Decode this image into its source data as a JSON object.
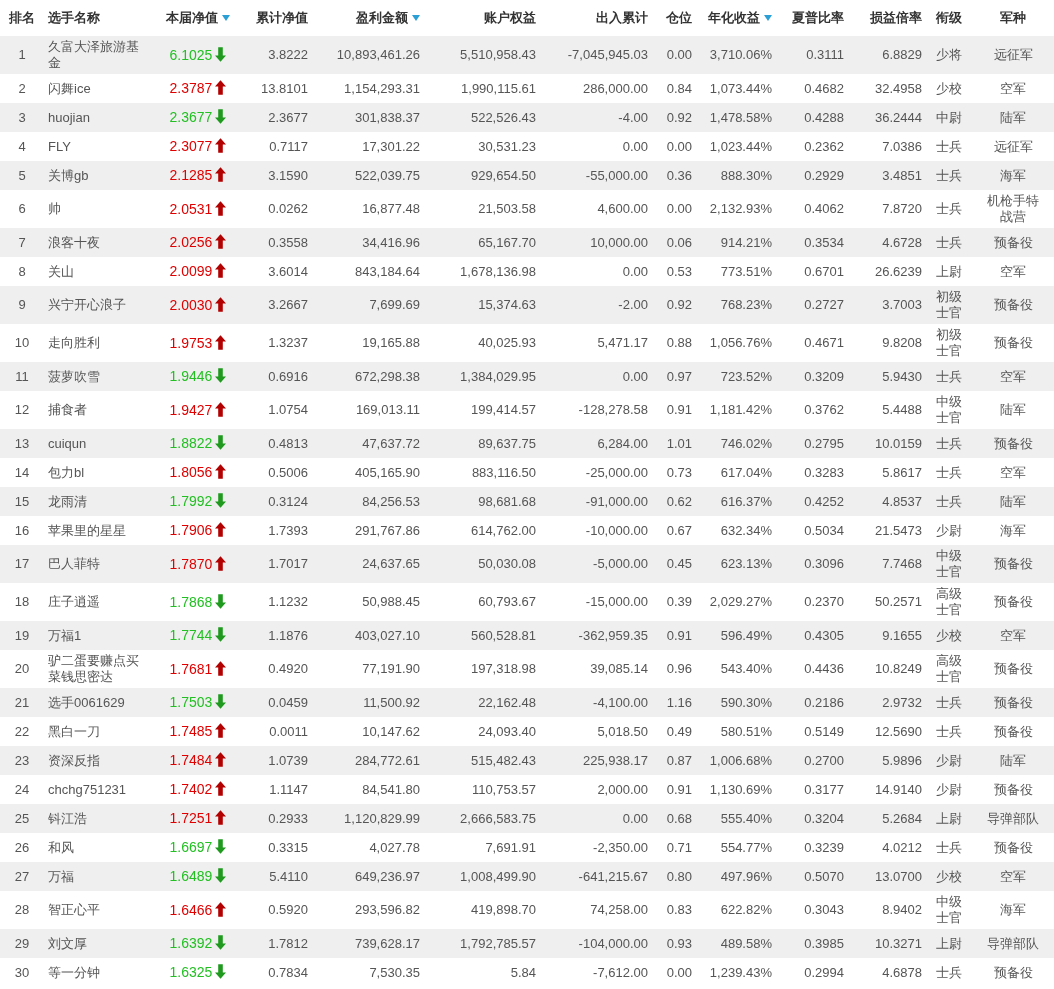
{
  "table": {
    "columns": [
      {
        "label": "排名",
        "sort_icon": false
      },
      {
        "label": "选手名称",
        "sort_icon": false
      },
      {
        "label": "本届净值",
        "sort_icon": true
      },
      {
        "label": "累计净值",
        "sort_icon": false
      },
      {
        "label": "盈利金额",
        "sort_icon": true
      },
      {
        "label": "账户权益",
        "sort_icon": false
      },
      {
        "label": "出入累计",
        "sort_icon": false
      },
      {
        "label": "仓位",
        "sort_icon": false
      },
      {
        "label": "年化收益",
        "sort_icon": true
      },
      {
        "label": "夏普比率",
        "sort_icon": false
      },
      {
        "label": "损益倍率",
        "sort_icon": false
      },
      {
        "label": "衔级",
        "sort_icon": false
      },
      {
        "label": "军种",
        "sort_icon": false
      }
    ],
    "rows": [
      {
        "rising": false,
        "cells": [
          "1",
          "久富大泽旅游基金",
          "6.1025",
          "3.8222",
          "10,893,461.26",
          "5,510,958.43",
          "-7,045,945.03",
          "0.00",
          "3,710.06%",
          "0.3111",
          "6.8829",
          "少将",
          "远征军"
        ]
      },
      {
        "rising": true,
        "cells": [
          "2",
          "闪舞ice",
          "2.3787",
          "13.8101",
          "1,154,293.31",
          "1,990,115.61",
          "286,000.00",
          "0.84",
          "1,073.44%",
          "0.4682",
          "32.4958",
          "少校",
          "空军"
        ]
      },
      {
        "rising": false,
        "cells": [
          "3",
          "huojian",
          "2.3677",
          "2.3677",
          "301,838.37",
          "522,526.43",
          "-4.00",
          "0.92",
          "1,478.58%",
          "0.4288",
          "36.2444",
          "中尉",
          "陆军"
        ]
      },
      {
        "rising": true,
        "cells": [
          "4",
          "FLY",
          "2.3077",
          "0.7117",
          "17,301.22",
          "30,531.23",
          "0.00",
          "0.00",
          "1,023.44%",
          "0.2362",
          "7.0386",
          "士兵",
          "远征军"
        ]
      },
      {
        "rising": true,
        "cells": [
          "5",
          "关博gb",
          "2.1285",
          "3.1590",
          "522,039.75",
          "929,654.50",
          "-55,000.00",
          "0.36",
          "888.30%",
          "0.2929",
          "3.4851",
          "士兵",
          "海军"
        ]
      },
      {
        "rising": true,
        "cells": [
          "6",
          "帅",
          "2.0531",
          "0.0262",
          "16,877.48",
          "21,503.58",
          "4,600.00",
          "0.00",
          "2,132.93%",
          "0.4062",
          "7.8720",
          "士兵",
          "机枪手特战营"
        ]
      },
      {
        "rising": true,
        "cells": [
          "7",
          "浪客十夜",
          "2.0256",
          "0.3558",
          "34,416.96",
          "65,167.70",
          "10,000.00",
          "0.06",
          "914.21%",
          "0.3534",
          "4.6728",
          "士兵",
          "预备役"
        ]
      },
      {
        "rising": true,
        "cells": [
          "8",
          "关山",
          "2.0099",
          "3.6014",
          "843,184.64",
          "1,678,136.98",
          "0.00",
          "0.53",
          "773.51%",
          "0.6701",
          "26.6239",
          "上尉",
          "空军"
        ]
      },
      {
        "rising": true,
        "cells": [
          "9",
          "兴宁开心浪子",
          "2.0030",
          "3.2667",
          "7,699.69",
          "15,374.63",
          "-2.00",
          "0.92",
          "768.23%",
          "0.2727",
          "3.7003",
          "初级士官",
          "预备役"
        ]
      },
      {
        "rising": true,
        "cells": [
          "10",
          "走向胜利",
          "1.9753",
          "1.3237",
          "19,165.88",
          "40,025.93",
          "5,471.17",
          "0.88",
          "1,056.76%",
          "0.4671",
          "9.8208",
          "初级士官",
          "预备役"
        ]
      },
      {
        "rising": false,
        "cells": [
          "11",
          "菠萝吹雪",
          "1.9446",
          "0.6916",
          "672,298.38",
          "1,384,029.95",
          "0.00",
          "0.97",
          "723.52%",
          "0.3209",
          "5.9430",
          "士兵",
          "空军"
        ]
      },
      {
        "rising": true,
        "cells": [
          "12",
          "捕食者",
          "1.9427",
          "1.0754",
          "169,013.11",
          "199,414.57",
          "-128,278.58",
          "0.91",
          "1,181.42%",
          "0.3762",
          "5.4488",
          "中级士官",
          "陆军"
        ]
      },
      {
        "rising": false,
        "cells": [
          "13",
          "cuiqun",
          "1.8822",
          "0.4813",
          "47,637.72",
          "89,637.75",
          "6,284.00",
          "1.01",
          "746.02%",
          "0.2795",
          "10.0159",
          "士兵",
          "预备役"
        ]
      },
      {
        "rising": true,
        "cells": [
          "14",
          "包力bl",
          "1.8056",
          "0.5006",
          "405,165.90",
          "883,116.50",
          "-25,000.00",
          "0.73",
          "617.04%",
          "0.3283",
          "5.8617",
          "士兵",
          "空军"
        ]
      },
      {
        "rising": false,
        "cells": [
          "15",
          "龙雨清",
          "1.7992",
          "0.3124",
          "84,256.53",
          "98,681.68",
          "-91,000.00",
          "0.62",
          "616.37%",
          "0.4252",
          "4.8537",
          "士兵",
          "陆军"
        ]
      },
      {
        "rising": true,
        "cells": [
          "16",
          "苹果里的星星",
          "1.7906",
          "1.7393",
          "291,767.86",
          "614,762.00",
          "-10,000.00",
          "0.67",
          "632.34%",
          "0.5034",
          "21.5473",
          "少尉",
          "海军"
        ]
      },
      {
        "rising": true,
        "cells": [
          "17",
          "巴人菲特",
          "1.7870",
          "1.7017",
          "24,637.65",
          "50,030.08",
          "-5,000.00",
          "0.45",
          "623.13%",
          "0.3096",
          "7.7468",
          "中级士官",
          "预备役"
        ]
      },
      {
        "rising": false,
        "cells": [
          "18",
          "庄子逍遥",
          "1.7868",
          "1.1232",
          "50,988.45",
          "60,793.67",
          "-15,000.00",
          "0.39",
          "2,029.27%",
          "0.2370",
          "50.2571",
          "高级士官",
          "预备役"
        ]
      },
      {
        "rising": false,
        "cells": [
          "19",
          "万福1",
          "1.7744",
          "1.1876",
          "403,027.10",
          "560,528.81",
          "-362,959.35",
          "0.91",
          "596.49%",
          "0.4305",
          "9.1655",
          "少校",
          "空军"
        ]
      },
      {
        "rising": true,
        "cells": [
          "20",
          "驴二蛋要赚点买菜钱思密达",
          "1.7681",
          "0.4920",
          "77,191.90",
          "197,318.98",
          "39,085.14",
          "0.96",
          "543.40%",
          "0.4436",
          "10.8249",
          "高级士官",
          "预备役"
        ]
      },
      {
        "rising": false,
        "cells": [
          "21",
          "选手0061629",
          "1.7503",
          "0.0459",
          "11,500.92",
          "22,162.48",
          "-4,100.00",
          "1.16",
          "590.30%",
          "0.2186",
          "2.9732",
          "士兵",
          "预备役"
        ]
      },
      {
        "rising": true,
        "cells": [
          "22",
          "黑白一刀",
          "1.7485",
          "0.0011",
          "10,147.62",
          "24,093.40",
          "5,018.50",
          "0.49",
          "580.51%",
          "0.5149",
          "12.5690",
          "士兵",
          "预备役"
        ]
      },
      {
        "rising": true,
        "cells": [
          "23",
          "资深反指",
          "1.7484",
          "1.0739",
          "284,772.61",
          "515,482.43",
          "225,938.17",
          "0.87",
          "1,006.68%",
          "0.2700",
          "5.9896",
          "少尉",
          "陆军"
        ]
      },
      {
        "rising": true,
        "cells": [
          "24",
          "chchg751231",
          "1.7402",
          "1.1147",
          "84,541.80",
          "110,753.57",
          "2,000.00",
          "0.91",
          "1,130.69%",
          "0.3177",
          "14.9140",
          "少尉",
          "预备役"
        ]
      },
      {
        "rising": true,
        "cells": [
          "25",
          "钭江浩",
          "1.7251",
          "0.2933",
          "1,120,829.99",
          "2,666,583.75",
          "0.00",
          "0.68",
          "555.40%",
          "0.3204",
          "5.2684",
          "上尉",
          "导弹部队"
        ]
      },
      {
        "rising": false,
        "cells": [
          "26",
          "和风",
          "1.6697",
          "0.3315",
          "4,027.78",
          "7,691.91",
          "-2,350.00",
          "0.71",
          "554.77%",
          "0.3239",
          "4.0212",
          "士兵",
          "预备役"
        ]
      },
      {
        "rising": false,
        "cells": [
          "27",
          "万福",
          "1.6489",
          "5.4110",
          "649,236.97",
          "1,008,499.90",
          "-641,215.67",
          "0.80",
          "497.96%",
          "0.5070",
          "13.0700",
          "少校",
          "空军"
        ]
      },
      {
        "rising": true,
        "cells": [
          "28",
          "智正心平",
          "1.6466",
          "0.5920",
          "293,596.82",
          "419,898.70",
          "74,258.00",
          "0.83",
          "622.82%",
          "0.3043",
          "8.9402",
          "中级士官",
          "海军"
        ]
      },
      {
        "rising": false,
        "cells": [
          "29",
          "刘文厚",
          "1.6392",
          "1.7812",
          "739,628.17",
          "1,792,785.57",
          "-104,000.00",
          "0.93",
          "489.58%",
          "0.3985",
          "10.3271",
          "上尉",
          "导弹部队"
        ]
      },
      {
        "rising": false,
        "cells": [
          "30",
          "等一分钟",
          "1.6325",
          "0.7834",
          "7,530.35",
          "5.84",
          "-7,612.00",
          "0.00",
          "1,239.43%",
          "0.2994",
          "4.6878",
          "士兵",
          "预备役"
        ]
      }
    ]
  }
}
